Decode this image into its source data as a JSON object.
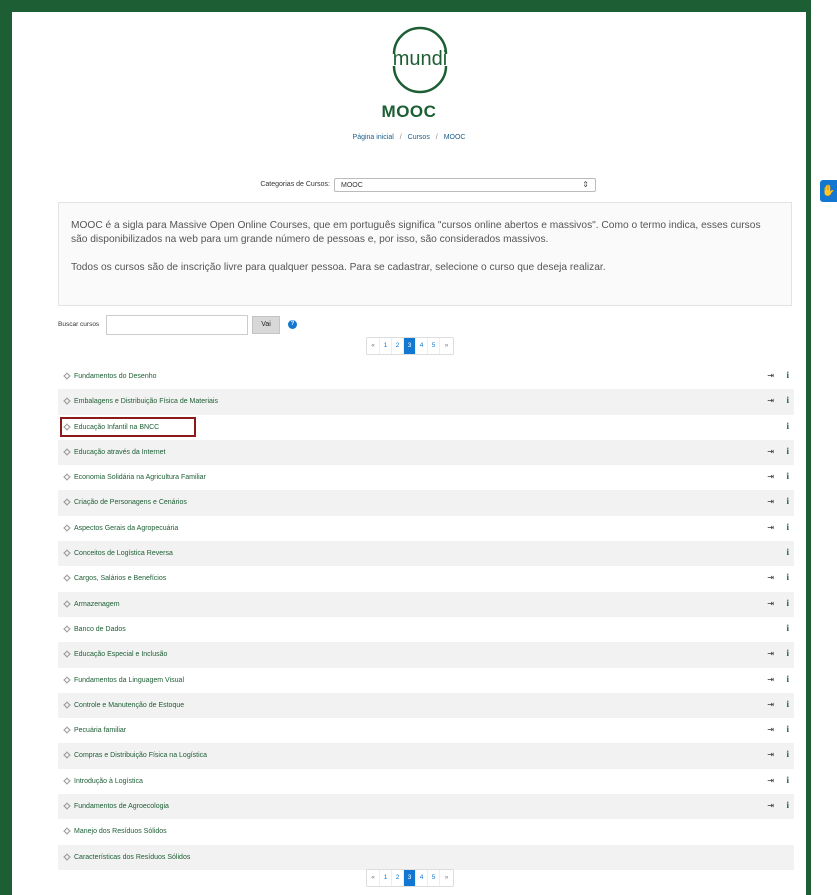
{
  "header": {
    "logo_text": "mundi",
    "site_title": "MOOC"
  },
  "breadcrumb": [
    "Página inicial",
    "Cursos",
    "MOOC"
  ],
  "category": {
    "label": "Categorias de Cursos:",
    "selected": "MOOC"
  },
  "summary": {
    "paragraph1": "MOOC é a sigla para Massive Open Online Courses, que em português significa \"cursos online abertos e massivos\". Como o termo indica, esses cursos são disponibilizados na web para um grande número de pessoas e, por isso, são considerados massivos.",
    "paragraph2": "Todos os cursos são de inscrição livre para qualquer pessoa. Para se cadastrar, selecione o curso que deseja realizar."
  },
  "search": {
    "label": "Buscar cursos",
    "value": "",
    "button_label": "Vai",
    "help_icon": "question-icon"
  },
  "pagination": {
    "prev": "«",
    "next": "»",
    "pages": [
      "1",
      "2",
      "3",
      "4",
      "5"
    ],
    "current": "3"
  },
  "courses": [
    {
      "name": "Fundamentos do Desenho",
      "enrol": true,
      "info": "i"
    },
    {
      "name": "Embalagens e Distribuição Física de Materiais",
      "enrol": true,
      "info": "i"
    },
    {
      "name": "Educação Infantil na BNCC",
      "enrol": false,
      "info": "i",
      "highlighted": true
    },
    {
      "name": "Educação através da Internet",
      "enrol": true,
      "info": "i"
    },
    {
      "name": "Economia Solidária na Agricultura Familiar",
      "enrol": true,
      "info": "i"
    },
    {
      "name": "Criação de Personagens e Cenários",
      "enrol": true,
      "info": "i"
    },
    {
      "name": "Aspectos Gerais da Agropecuária",
      "enrol": true,
      "info": "i"
    },
    {
      "name": "Conceitos de Logística Reversa",
      "enrol": false,
      "info": "i"
    },
    {
      "name": "Cargos, Salários e Benefícios",
      "enrol": true,
      "info": "i"
    },
    {
      "name": "Armazenagem",
      "enrol": true,
      "info": "i"
    },
    {
      "name": "Banco de Dados",
      "enrol": false,
      "info": "i"
    },
    {
      "name": "Educação Especial e Inclusão",
      "enrol": true,
      "info": "i"
    },
    {
      "name": "Fundamentos da Linguagem Visual",
      "enrol": true,
      "info": "i"
    },
    {
      "name": "Controle e Manutenção de Estoque",
      "enrol": true,
      "info": "i"
    },
    {
      "name": "Pecuária familiar",
      "enrol": true,
      "info": "i"
    },
    {
      "name": "Compras e Distribuição Física na Logística",
      "enrol": true,
      "info": "i"
    },
    {
      "name": "Introdução à Logística",
      "enrol": true,
      "info": "i"
    },
    {
      "name": "Fundamentos de Agroecologia",
      "enrol": true,
      "info": "i"
    },
    {
      "name": "Manejo dos Resíduos Sólidos",
      "enrol": false,
      "info": ""
    },
    {
      "name": "Características dos Resíduos Sólidos",
      "enrol": false,
      "info": ""
    }
  ],
  "colors": {
    "brand_green": "#1d5e34",
    "accent_blue": "#1177d1",
    "highlight_border": "#8b1a1a"
  }
}
